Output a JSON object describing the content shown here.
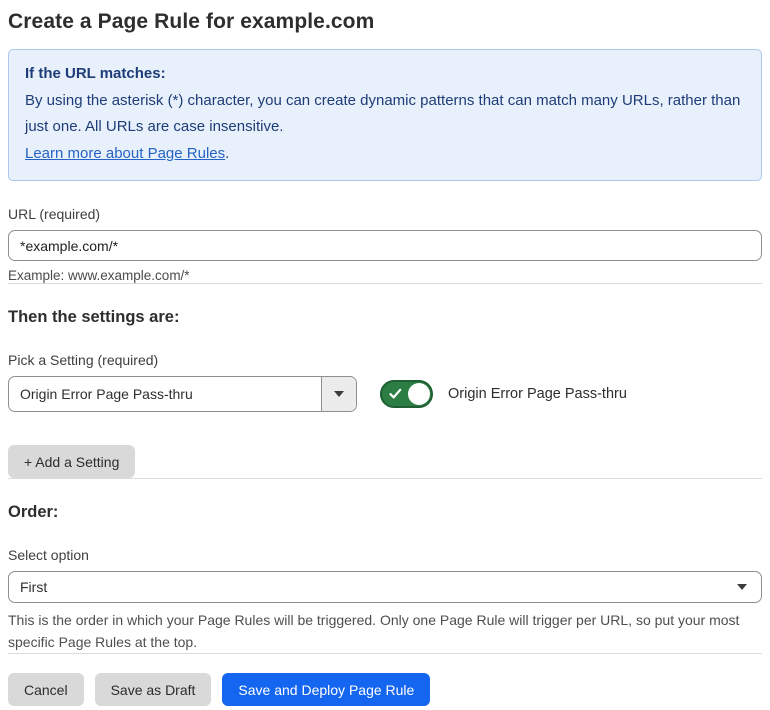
{
  "page": {
    "title": "Create a Page Rule for example.com"
  },
  "info_box": {
    "heading": "If the URL matches:",
    "body": "By using the asterisk (*) character, you can create dynamic patterns that can match many URLs, rather than just one. All URLs are case insensitive.",
    "link_label": "Learn more about Page Rules",
    "link_suffix": "."
  },
  "url_section": {
    "label": "URL (required)",
    "input_value": "*example.com/*",
    "helper": "Example: www.example.com/*"
  },
  "settings_section": {
    "heading": "Then the settings are:",
    "picker_label": "Pick a Setting (required)",
    "selected_setting": "Origin Error Page Pass-thru",
    "toggle_state": "on",
    "toggle_label": "Origin Error Page Pass-thru",
    "add_setting_label": "+ Add a Setting"
  },
  "order_section": {
    "heading": "Order:",
    "select_label": "Select option",
    "selected_option": "First",
    "help_text": "This is the order in which your Page Rules will be triggered. Only one Page Rule will trigger per URL, so put your most specific Page Rules at the top."
  },
  "footer": {
    "cancel_label": "Cancel",
    "save_draft_label": "Save as Draft",
    "save_deploy_label": "Save and Deploy Page Rule"
  },
  "colors": {
    "info_bg": "#e8f1fb",
    "info_border": "#abc9ec",
    "info_text": "#1e3c78",
    "link": "#2563c4",
    "toggle_on": "#2c7d44",
    "primary_button": "#1466f0",
    "secondary_button": "#d9d9d9"
  }
}
